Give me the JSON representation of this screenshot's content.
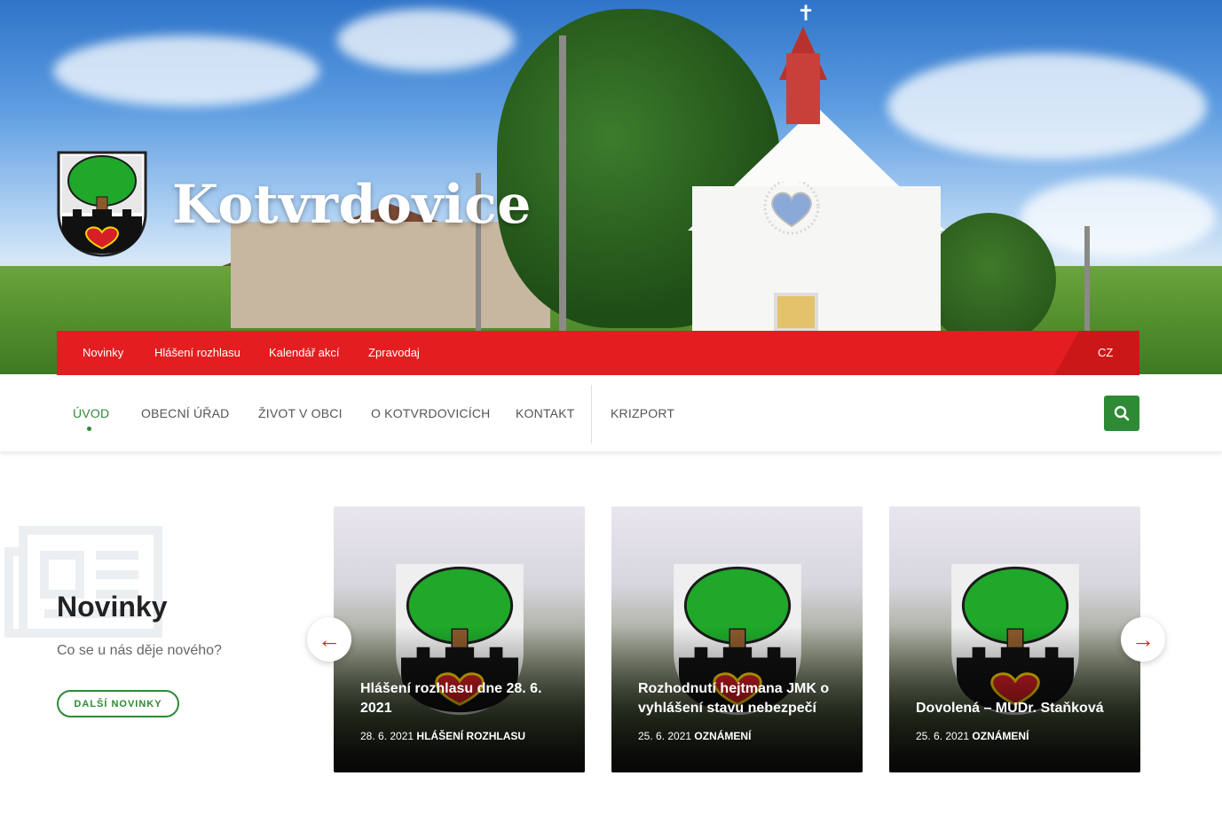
{
  "site": {
    "title": "Kotvrdovice"
  },
  "top_nav": {
    "items": [
      "Novinky",
      "Hlášení rozhlasu",
      "Kalendář akcí",
      "Zpravodaj"
    ],
    "lang": "CZ"
  },
  "main_nav": {
    "items": [
      "Úvod",
      "Obecní úřad",
      "Život v obci",
      "O Kotvrdovicích",
      "Kontakt",
      "KRIZPORT"
    ],
    "active": "Úvod"
  },
  "news": {
    "heading": "Novinky",
    "subheading": "Co se u nás děje nového?",
    "more_label": "DALŠÍ NOVINKY",
    "cards": [
      {
        "title": "Hlášení rozhlasu dne 28. 6. 2021",
        "date": "28. 6. 2021",
        "category": "HLÁŠENÍ ROZHLASU"
      },
      {
        "title": "Rozhodnutí hejtmana JMK o vyhlášení stavu nebezpečí",
        "date": "25. 6. 2021",
        "category": "OZNÁMENÍ"
      },
      {
        "title": "Dovolená – MUDr. Staňková",
        "date": "25. 6. 2021",
        "category": "OZNÁMENÍ"
      }
    ]
  },
  "icons": {
    "search": "search-icon",
    "prev": "arrow-left-icon",
    "next": "arrow-right-icon",
    "crest": "coat-of-arms-icon",
    "news": "newspaper-icon"
  },
  "colors": {
    "brand_red": "#e41e20",
    "brand_green": "#2e8a35"
  }
}
